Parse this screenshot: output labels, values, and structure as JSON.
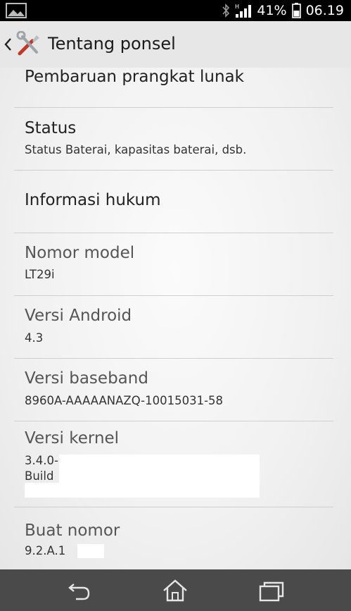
{
  "status_bar": {
    "battery_percent": "41%",
    "time": "06.19",
    "icons": [
      "gallery-icon",
      "bluetooth-icon",
      "signal-icon",
      "battery-icon"
    ]
  },
  "header": {
    "title": "Tentang ponsel",
    "icons": [
      "back-chevron-icon",
      "settings-tools-icon"
    ]
  },
  "items": [
    {
      "title": "Pembaruan prangkat lunak"
    },
    {
      "title": "Status",
      "subtitle": "Status Baterai, kapasitas baterai, dsb."
    },
    {
      "title": "Informasi hukum"
    },
    {
      "title": "Nomor model",
      "subtitle": "LT29i"
    },
    {
      "title": "Versi Android",
      "subtitle": "4.3"
    },
    {
      "title": "Versi baseband",
      "subtitle": "8960A-AAAAANAZQ-10015031-58"
    },
    {
      "title": "Versi kernel",
      "subtitle": "3.4.0-",
      "subtitle2": "Build"
    },
    {
      "title": "Buat nomor",
      "subtitle": "9.2.A.1"
    }
  ],
  "nav": {
    "icons": [
      "back-icon",
      "home-icon",
      "recent-apps-icon"
    ]
  }
}
